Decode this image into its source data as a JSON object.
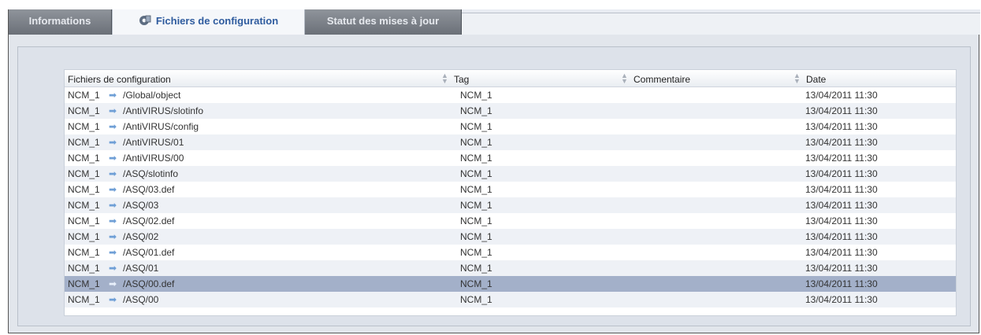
{
  "tabs": [
    {
      "label": "Informations",
      "active": false
    },
    {
      "label": "Fichiers de configuration",
      "active": true,
      "icon": "config-files-icon"
    },
    {
      "label": "Statut des mises à jour",
      "active": false
    }
  ],
  "table": {
    "columns": [
      "Fichiers de configuration",
      "Tag",
      "Commentaire",
      "Date"
    ],
    "rows": [
      {
        "source": "NCM_1",
        "path": "/Global/object",
        "tag": "NCM_1",
        "comment": "",
        "date": "13/04/2011 11:30"
      },
      {
        "source": "NCM_1",
        "path": "/AntiVIRUS/slotinfo",
        "tag": "NCM_1",
        "comment": "",
        "date": "13/04/2011 11:30"
      },
      {
        "source": "NCM_1",
        "path": "/AntiVIRUS/config",
        "tag": "NCM_1",
        "comment": "",
        "date": "13/04/2011 11:30"
      },
      {
        "source": "NCM_1",
        "path": "/AntiVIRUS/01",
        "tag": "NCM_1",
        "comment": "",
        "date": "13/04/2011 11:30"
      },
      {
        "source": "NCM_1",
        "path": "/AntiVIRUS/00",
        "tag": "NCM_1",
        "comment": "",
        "date": "13/04/2011 11:30"
      },
      {
        "source": "NCM_1",
        "path": "/ASQ/slotinfo",
        "tag": "NCM_1",
        "comment": "",
        "date": "13/04/2011 11:30"
      },
      {
        "source": "NCM_1",
        "path": "/ASQ/03.def",
        "tag": "NCM_1",
        "comment": "",
        "date": "13/04/2011 11:30"
      },
      {
        "source": "NCM_1",
        "path": "/ASQ/03",
        "tag": "NCM_1",
        "comment": "",
        "date": "13/04/2011 11:30"
      },
      {
        "source": "NCM_1",
        "path": "/ASQ/02.def",
        "tag": "NCM_1",
        "comment": "",
        "date": "13/04/2011 11:30"
      },
      {
        "source": "NCM_1",
        "path": "/ASQ/02",
        "tag": "NCM_1",
        "comment": "",
        "date": "13/04/2011 11:30"
      },
      {
        "source": "NCM_1",
        "path": "/ASQ/01.def",
        "tag": "NCM_1",
        "comment": "",
        "date": "13/04/2011 11:30"
      },
      {
        "source": "NCM_1",
        "path": "/ASQ/01",
        "tag": "NCM_1",
        "comment": "",
        "date": "13/04/2011 11:30"
      },
      {
        "source": "NCM_1",
        "path": "/ASQ/00.def",
        "tag": "NCM_1",
        "comment": "",
        "date": "13/04/2011 11:30",
        "selected": true
      },
      {
        "source": "NCM_1",
        "path": "/ASQ/00",
        "tag": "NCM_1",
        "comment": "",
        "date": "13/04/2011 11:30"
      }
    ]
  },
  "colors": {
    "tab_active_text": "#2e5b9e",
    "tab_inactive_bg": "#7d828a",
    "row_selected": "#a3b0c9",
    "row_alt": "#eef1f6",
    "arrow": "#6f9fd6"
  },
  "icons": {
    "row_link": "arrow-right-icon",
    "sort": "sort-icon"
  }
}
